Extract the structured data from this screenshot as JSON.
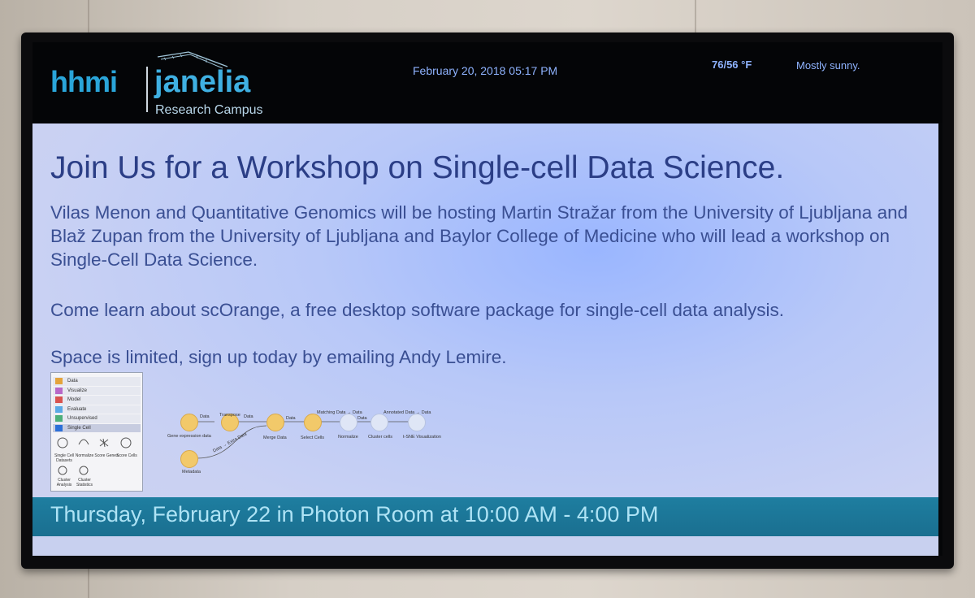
{
  "header": {
    "logo_hhmi": "hhmi",
    "logo_janelia": "janelia",
    "logo_subtitle": "Research Campus",
    "datetime": "February 20, 2018 05:17 PM",
    "temperature": "76/56 °F",
    "weather": "Mostly sunny."
  },
  "slide": {
    "title": "Join Us for a Workshop on Single-cell Data Science.",
    "paragraph1": "Vilas Menon and Quantitative Genomics will be hosting Martin Stražar from the University of Ljubljana and Blaž Zupan from the University of Ljubljana and Baylor College of Medicine  who will lead a workshop on Single-Cell Data Science.",
    "paragraph2": "Come learn about scOrange, a free desktop software package for single-cell data analysis.",
    "paragraph3": "Space is limited, sign up today by emailing Andy Lemire.",
    "footer": "Thursday, February 22 in Photon Room at 10:00 AM - 4:00 PM"
  },
  "screenshot_sidebar": {
    "items": [
      "Data",
      "Visualize",
      "Model",
      "Evaluate",
      "Unsupervised",
      "Single Cell"
    ],
    "icon_colors": [
      "#e4a33b",
      "#b868c8",
      "#d9534f",
      "#5aa9e6",
      "#4caf7a",
      "#2b6fd8"
    ],
    "widgets": [
      "Single Cell Datasets",
      "Normalize",
      "Score Genes",
      "Score Cells",
      "Cluster Analysis",
      "Cluster Statistics"
    ]
  },
  "screenshot_workflow": {
    "nodes": [
      "Gene expression data",
      "Transpose",
      "Merge Data",
      "Select Cells",
      "Normalize",
      "Cluster cells",
      "t-SNE Visualization",
      "Metadata"
    ],
    "link_labels": [
      "Data",
      "Data",
      "Data",
      "Matching Data → Data",
      "Data",
      "Annotated Data → Data",
      "Data → Extra Data"
    ]
  }
}
